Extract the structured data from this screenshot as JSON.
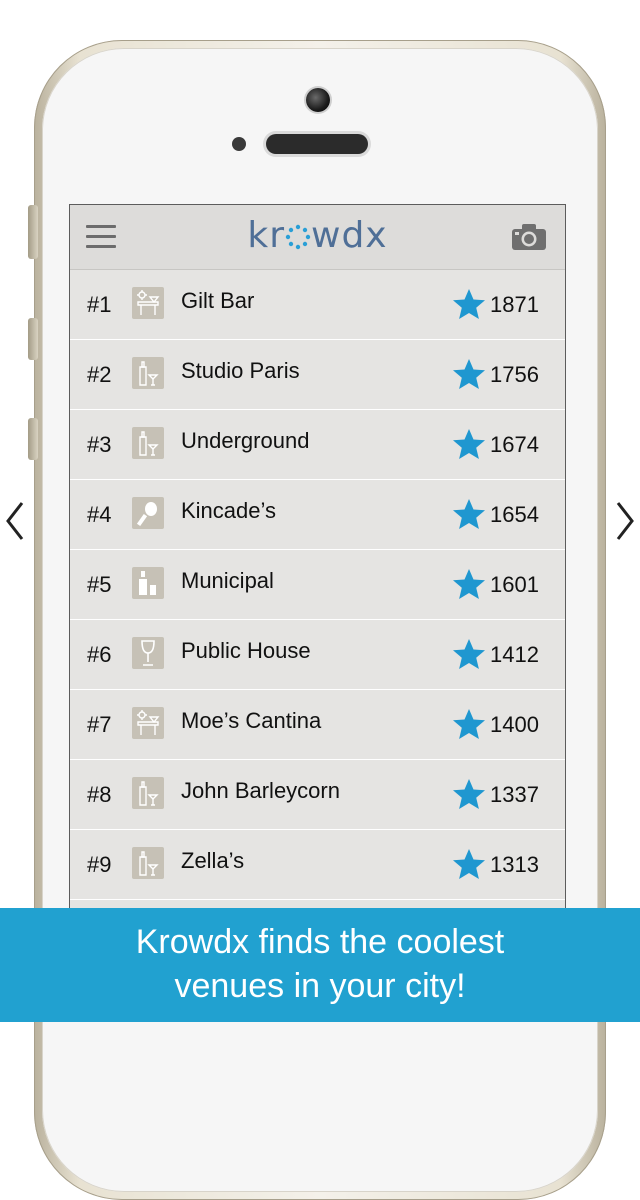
{
  "app": {
    "logo": "kr∘wdx"
  },
  "header": {
    "menu_icon": "hamburger-menu-icon",
    "camera_icon": "camera-icon"
  },
  "colors": {
    "accent": "#21a1d0",
    "star": "#1f97d0",
    "logo": "#4f6f97"
  },
  "venues": [
    {
      "rank": "#1",
      "name": "Gilt Bar",
      "score": "1871",
      "icon": "lounge-icon"
    },
    {
      "rank": "#2",
      "name": "Studio Paris",
      "score": "1756",
      "icon": "cocktail-bar-icon"
    },
    {
      "rank": "#3",
      "name": "Underground",
      "score": "1674",
      "icon": "cocktail-bar-icon"
    },
    {
      "rank": "#4",
      "name": "Kincade’s",
      "score": "1654",
      "icon": "sports-bar-icon"
    },
    {
      "rank": "#5",
      "name": "Municipal",
      "score": "1601",
      "icon": "bottle-icon"
    },
    {
      "rank": "#6",
      "name": "Public House",
      "score": "1412",
      "icon": "wine-glass-icon"
    },
    {
      "rank": "#7",
      "name": " Moe’s Cantina",
      "score": "1400",
      "icon": "lounge-icon"
    },
    {
      "rank": "#8",
      "name": "John Barleycorn",
      "score": "1337",
      "icon": "cocktail-bar-icon"
    },
    {
      "rank": "#9",
      "name": "Zella’s",
      "score": "1313",
      "icon": "cocktail-bar-icon"
    }
  ],
  "banner": {
    "line1": "Krowdx finds the coolest",
    "line2": "venues in your city!"
  }
}
